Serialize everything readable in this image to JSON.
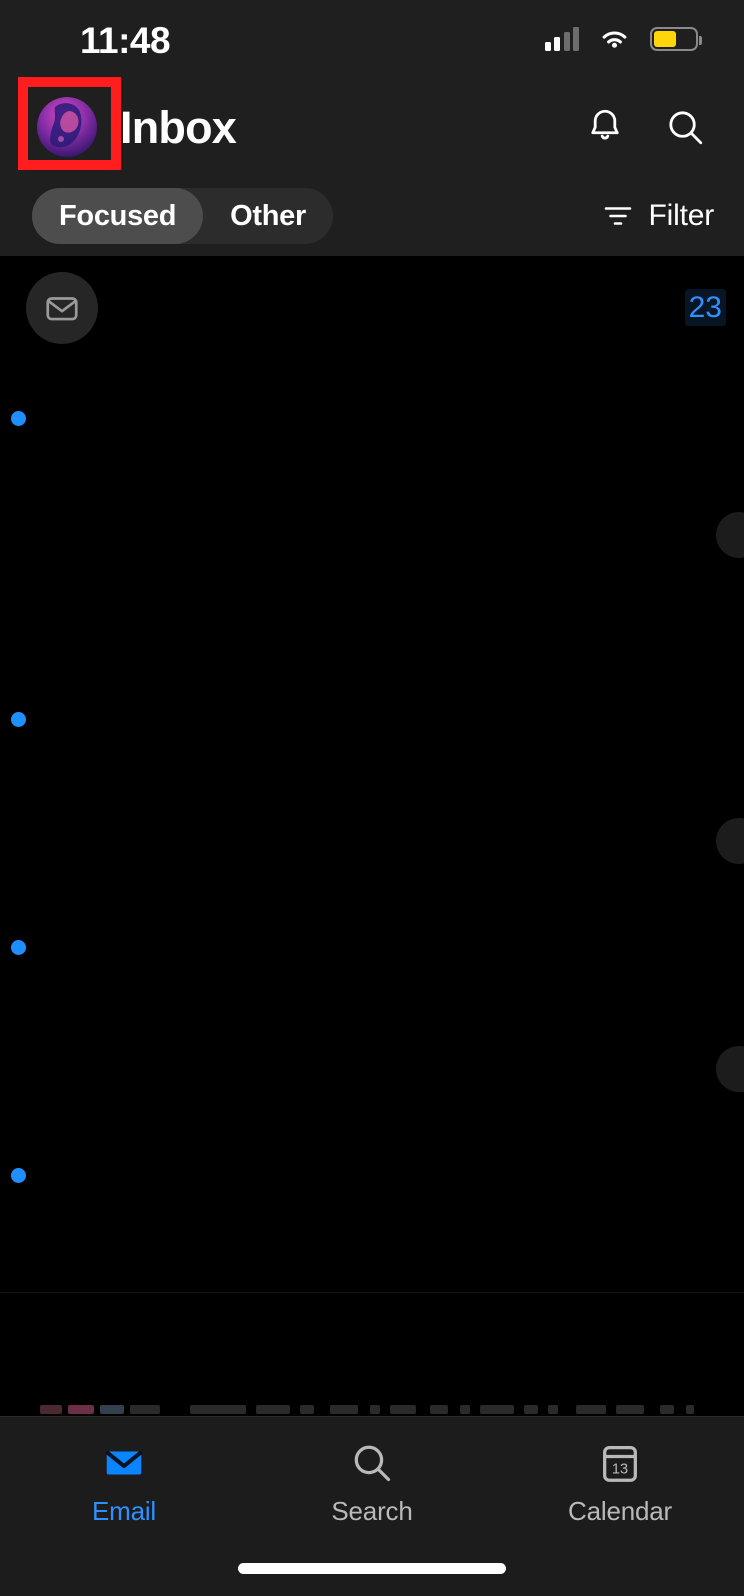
{
  "status_bar": {
    "time": "11:48",
    "cellular_icon": "cellular-signal-icon",
    "cellular_bars_filled": 2,
    "cellular_bars_total": 4,
    "wifi_icon": "wifi-icon",
    "battery_icon": "battery-icon",
    "battery_fill_percent": 55,
    "battery_color": "#ffd60a",
    "low_power_mode": true
  },
  "header": {
    "avatar": {
      "icon": "account-avatar",
      "highlighted": true,
      "highlight_color": "#ff1d1d"
    },
    "title": "Inbox",
    "actions": [
      {
        "icon": "bell-icon",
        "label": "Notifications"
      },
      {
        "icon": "search-icon",
        "label": "Search"
      }
    ],
    "segmented_control": {
      "selected": "Focused",
      "options": [
        {
          "label": "Focused",
          "selected": true
        },
        {
          "label": "Other",
          "selected": false
        }
      ]
    },
    "filter": {
      "icon": "filter-icon",
      "label": "Filter"
    }
  },
  "message_list": {
    "mail_chip_icon": "envelope-icon",
    "count_badge": "23",
    "unread_indicator_color": "#1f8fff",
    "unread_count": 4,
    "rows_redacted": true
  },
  "tab_bar": {
    "active": "Email",
    "items": [
      {
        "label": "Email",
        "icon": "envelope-filled-icon",
        "active": true
      },
      {
        "label": "Search",
        "icon": "search-icon",
        "active": false
      },
      {
        "label": "Calendar",
        "icon": "calendar-icon",
        "calendar_day": "13",
        "active": false
      }
    ],
    "active_color": "#2f8fff",
    "inactive_color": "#b9b9b9"
  },
  "home_indicator": {
    "present": true
  }
}
